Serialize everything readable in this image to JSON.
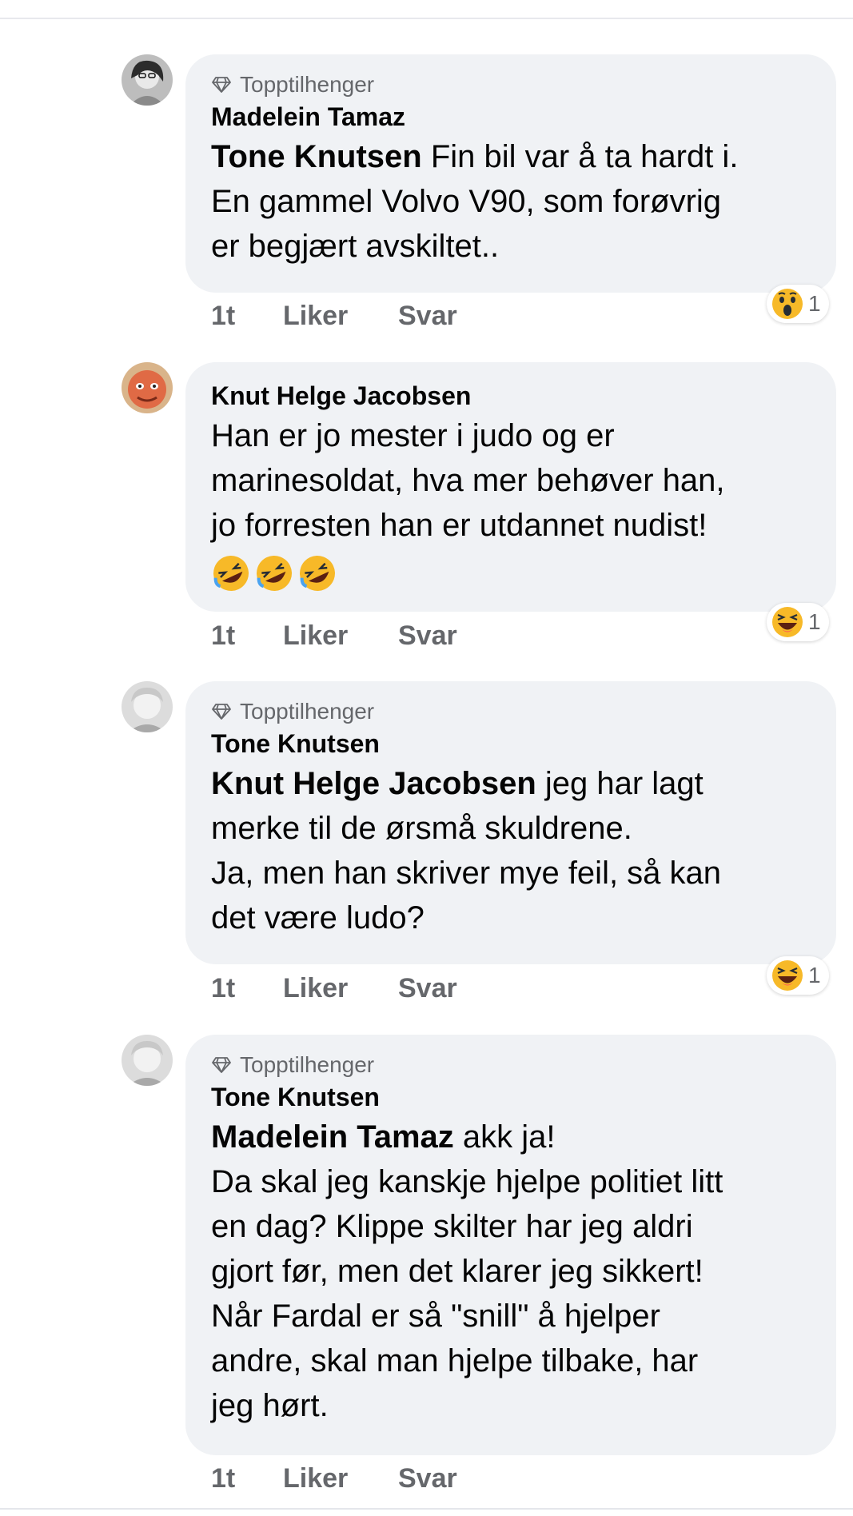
{
  "comments": [
    {
      "badge": "Topptilhenger",
      "author": "Madelein Tamaz",
      "mention": "Tone Knutsen",
      "lines": [
        " Fin bil var å ta hardt i.",
        "En gammel Volvo V90, som forøvrig",
        "er begjært avskiltet.."
      ],
      "time": "1t",
      "like": "Liker",
      "reply": "Svar",
      "reaction_count": "1",
      "reaction_icon": "wow-emoji-icon"
    },
    {
      "badge": "",
      "author": "Knut Helge Jacobsen",
      "mention": "",
      "lines": [
        "Han er jo mester i judo og er",
        "marinesoldat, hva mer behøver han,",
        "jo forresten han er utdannet nudist!"
      ],
      "emoji": "🤣🤣🤣",
      "time": "1t",
      "like": "Liker",
      "reply": "Svar",
      "reaction_count": "1",
      "reaction_icon": "haha-emoji-icon"
    },
    {
      "badge": "Topptilhenger",
      "author": "Tone Knutsen",
      "mention": "Knut Helge Jacobsen",
      "lines": [
        " jeg har lagt",
        "merke til de ørsmå skuldrene.",
        "Ja, men han skriver mye feil, så kan",
        "det være ludo?"
      ],
      "time": "1t",
      "like": "Liker",
      "reply": "Svar",
      "reaction_count": "1",
      "reaction_icon": "haha-emoji-icon"
    },
    {
      "badge": "Topptilhenger",
      "author": "Tone Knutsen",
      "mention": "Madelein Tamaz",
      "lines": [
        " akk ja!",
        "Da skal jeg kanskje hjelpe politiet litt",
        "en dag? Klippe skilter har jeg aldri",
        "gjort før, men det klarer jeg sikkert!",
        "Når Fardal er så \"snill\" å hjelper",
        "andre, skal man hjelpe tilbake, har",
        "jeg hørt."
      ],
      "time": "1t",
      "like": "Liker",
      "reply": "Svar"
    }
  ]
}
